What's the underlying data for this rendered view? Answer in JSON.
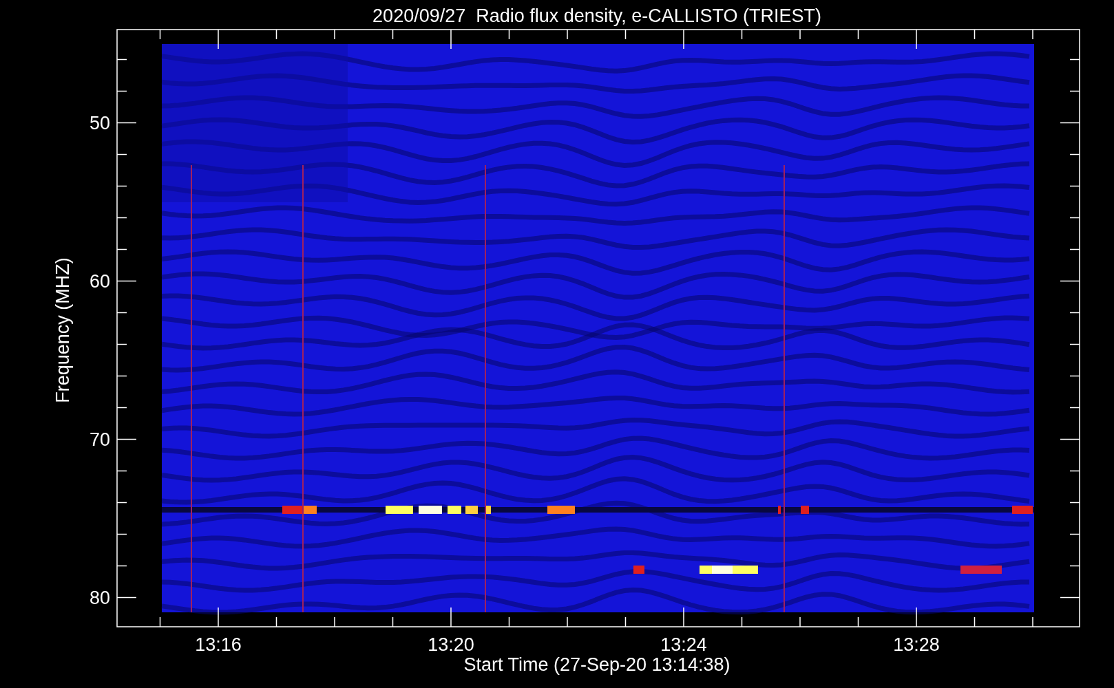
{
  "plot": {
    "title": "2020/09/27  Radio flux density, e-CALLISTO (TRIEST)",
    "x_axis": {
      "label": "Start Time (27-Sep-20 13:14:38)",
      "ticks": [
        "13:16",
        "13:20",
        "13:24",
        "13:28"
      ]
    },
    "y_axis": {
      "label": "Frequency (MHZ)",
      "ticks": [
        "50",
        "60",
        "70",
        "80"
      ]
    }
  }
}
